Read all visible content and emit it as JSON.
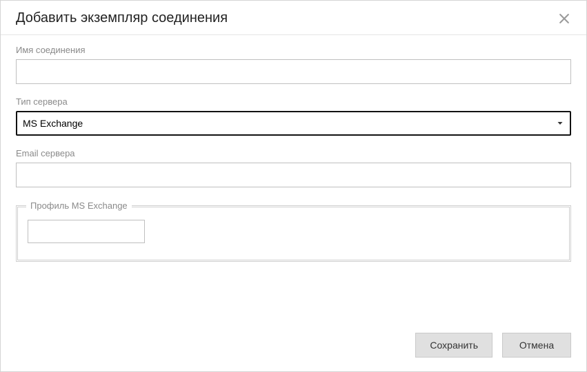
{
  "dialog": {
    "title": "Добавить экземпляр соединения"
  },
  "fields": {
    "connection_name": {
      "label": "Имя соединения",
      "value": ""
    },
    "server_type": {
      "label": "Тип сервера",
      "selected": "MS Exchange",
      "options": [
        "MS Exchange"
      ]
    },
    "server_email": {
      "label": "Email сервера",
      "value": ""
    }
  },
  "fieldset": {
    "legend": "Профиль MS Exchange",
    "profile": {
      "value": ""
    }
  },
  "buttons": {
    "save": "Сохранить",
    "cancel": "Отмена"
  }
}
